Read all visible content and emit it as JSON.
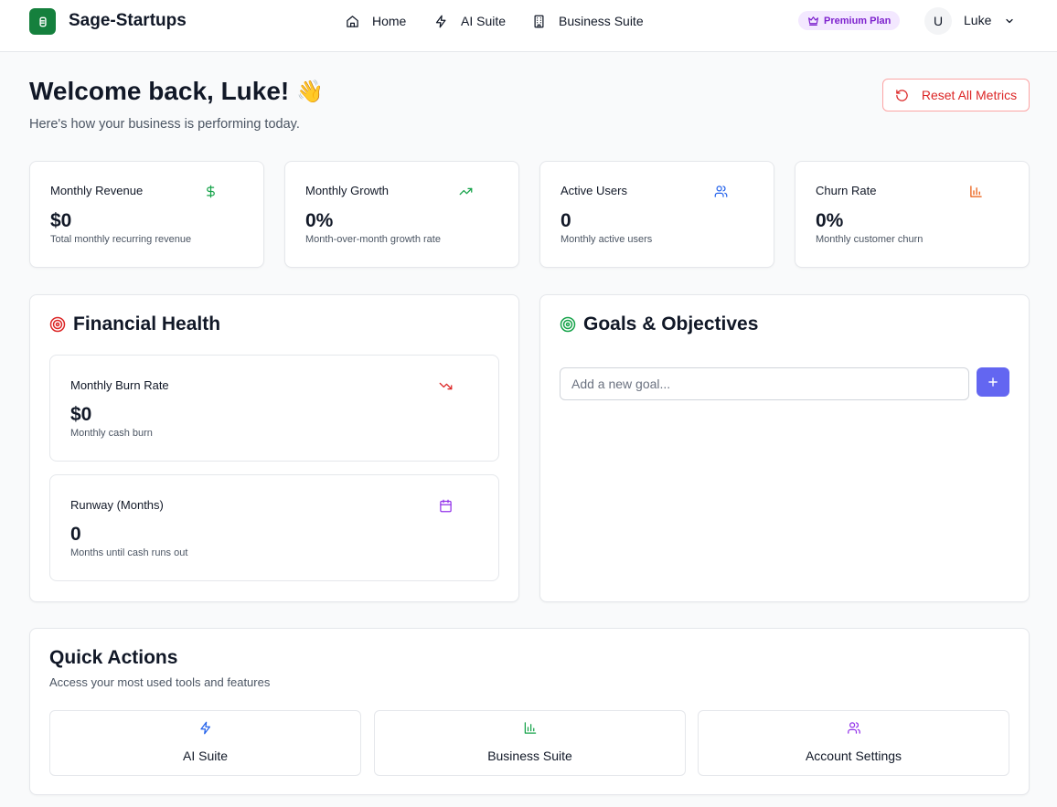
{
  "header": {
    "brand": "Sage-Startups",
    "nav": [
      {
        "label": "Home",
        "icon": "home-icon"
      },
      {
        "label": "AI Suite",
        "icon": "zap-icon"
      },
      {
        "label": "Business Suite",
        "icon": "building-icon"
      }
    ],
    "plan_badge": "Premium Plan",
    "user": {
      "initial": "U",
      "name": "Luke"
    }
  },
  "welcome": {
    "title": "Welcome back, Luke!",
    "emoji": "👋",
    "subtitle": "Here's how your business is performing today.",
    "reset_label": "Reset All Metrics"
  },
  "metrics": [
    {
      "title": "Monthly Revenue",
      "value": "$0",
      "desc": "Total monthly recurring revenue",
      "icon": "dollar-icon",
      "color": "#16a34a"
    },
    {
      "title": "Monthly Growth",
      "value": "0%",
      "desc": "Month-over-month growth rate",
      "icon": "trending-up-icon",
      "color": "#16a34a"
    },
    {
      "title": "Active Users",
      "value": "0",
      "desc": "Monthly active users",
      "icon": "users-icon",
      "color": "#2563eb"
    },
    {
      "title": "Churn Rate",
      "value": "0%",
      "desc": "Monthly customer churn",
      "icon": "bar-chart-icon",
      "color": "#ea580c"
    }
  ],
  "financial": {
    "title": "Financial Health",
    "items": [
      {
        "title": "Monthly Burn Rate",
        "value": "$0",
        "desc": "Monthly cash burn",
        "icon": "trending-down-icon",
        "color": "#dc2626"
      },
      {
        "title": "Runway (Months)",
        "value": "0",
        "desc": "Months until cash runs out",
        "icon": "calendar-icon",
        "color": "#9333ea"
      }
    ]
  },
  "goals": {
    "title": "Goals & Objectives",
    "input_value": "",
    "placeholder": "Add a new goal..."
  },
  "quick_actions": {
    "title": "Quick Actions",
    "subtitle": "Access your most used tools and features",
    "items": [
      {
        "label": "AI Suite",
        "icon": "zap-icon",
        "color": "#2563eb"
      },
      {
        "label": "Business Suite",
        "icon": "bar-chart-icon",
        "color": "#16a34a"
      },
      {
        "label": "Account Settings",
        "icon": "users-icon",
        "color": "#9333ea"
      }
    ]
  },
  "colors": {
    "brand": "#15803d",
    "accent": "#6366f1",
    "danger": "#dc2626",
    "premium_bg": "#f3e8ff",
    "premium_fg": "#7e22ce"
  }
}
